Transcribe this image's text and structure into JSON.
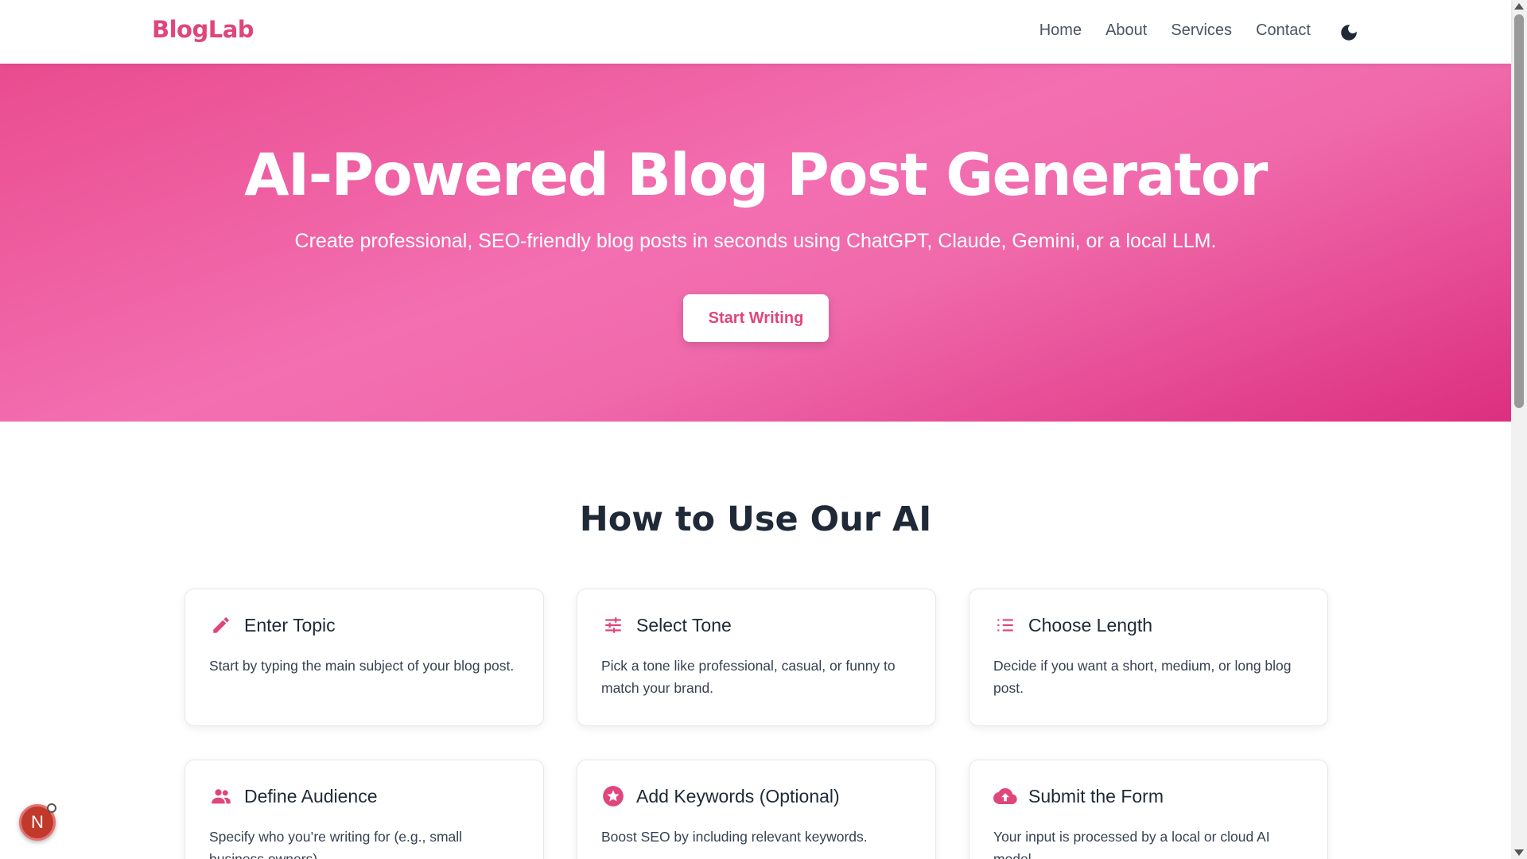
{
  "header": {
    "logo": "BlogLab",
    "nav": [
      "Home",
      "About",
      "Services",
      "Contact"
    ],
    "theme_icon": "moon-icon"
  },
  "hero": {
    "title": "AI-Powered Blog Post Generator",
    "subtitle": "Create professional, SEO-friendly blog posts in seconds using ChatGPT, Claude, Gemini, or a local LLM.",
    "cta_label": "Start Writing"
  },
  "steps_section": {
    "title": "How to Use Our AI",
    "cards": [
      {
        "icon": "pencil-icon",
        "title": "Enter Topic",
        "text": "Start by typing the main subject of your blog post."
      },
      {
        "icon": "sliders-icon",
        "title": "Select Tone",
        "text": "Pick a tone like professional, casual, or funny to match your brand."
      },
      {
        "icon": "list-icon",
        "title": "Choose Length",
        "text": "Decide if you want a short, medium, or long blog post."
      },
      {
        "icon": "people-icon",
        "title": "Define Audience",
        "text": "Specify who you’re writing for (e.g., small business owners)."
      },
      {
        "icon": "star-icon",
        "title": "Add Keywords (Optional)",
        "text": "Boost SEO by including relevant keywords."
      },
      {
        "icon": "cloud-upload-icon",
        "title": "Submit the Form",
        "text": "Your input is processed by a local or cloud AI model."
      }
    ]
  },
  "floating_badge": {
    "label": "N"
  },
  "colors": {
    "accent": "#e0457b",
    "hero_start": "#e94c8f",
    "hero_end": "#dc2f7f",
    "text_dark": "#1f2937"
  }
}
